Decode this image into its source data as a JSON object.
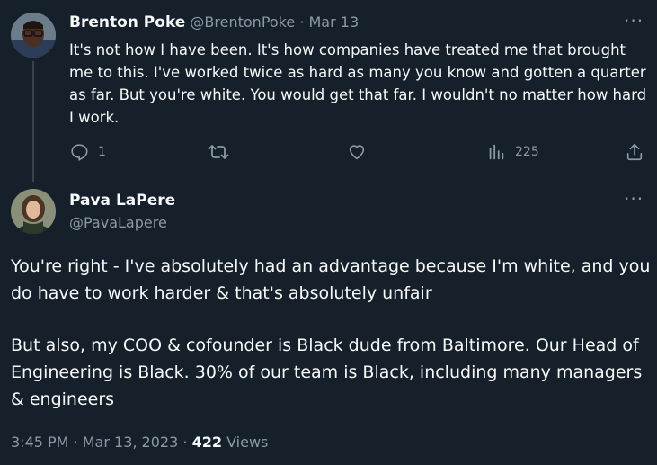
{
  "tweet1": {
    "name": "Brenton Poke",
    "handle": "@BrentonPoke",
    "sep": "·",
    "date": "Mar 13",
    "text": "It's not how I have been. It's how companies have treated me that brought me to this. I've worked twice as hard as many you know and gotten a quarter as far. But you're white. You would get that far. I wouldn't no matter how hard I work.",
    "reply_count": "1",
    "views_count": "225",
    "more_label": "···"
  },
  "tweet2": {
    "name": "Pava LaPere",
    "handle": "@PavaLapere",
    "more_label": "···",
    "para1": "You're right - I've absolutely had an advantage because I'm white, and you do have to work harder & that's absolutely unfair",
    "para2": "But also, my COO & cofounder is Black dude from Baltimore. Our Head of Engineering is Black. 30% of our team is Black, including many managers & engineers",
    "time": "3:45 PM",
    "sep": "·",
    "date": "Mar 13, 2023",
    "sep2": "·",
    "views_count": "422",
    "views_label": "Views"
  },
  "icons": {
    "reply": "reply-icon",
    "retweet": "retweet-icon",
    "like": "heart-icon",
    "views": "views-chart-icon",
    "share": "share-icon"
  },
  "colors": {
    "background": "#15202b",
    "text": "#f7f9f9",
    "muted": "#8b98a5",
    "thread_line": "#38444d"
  }
}
